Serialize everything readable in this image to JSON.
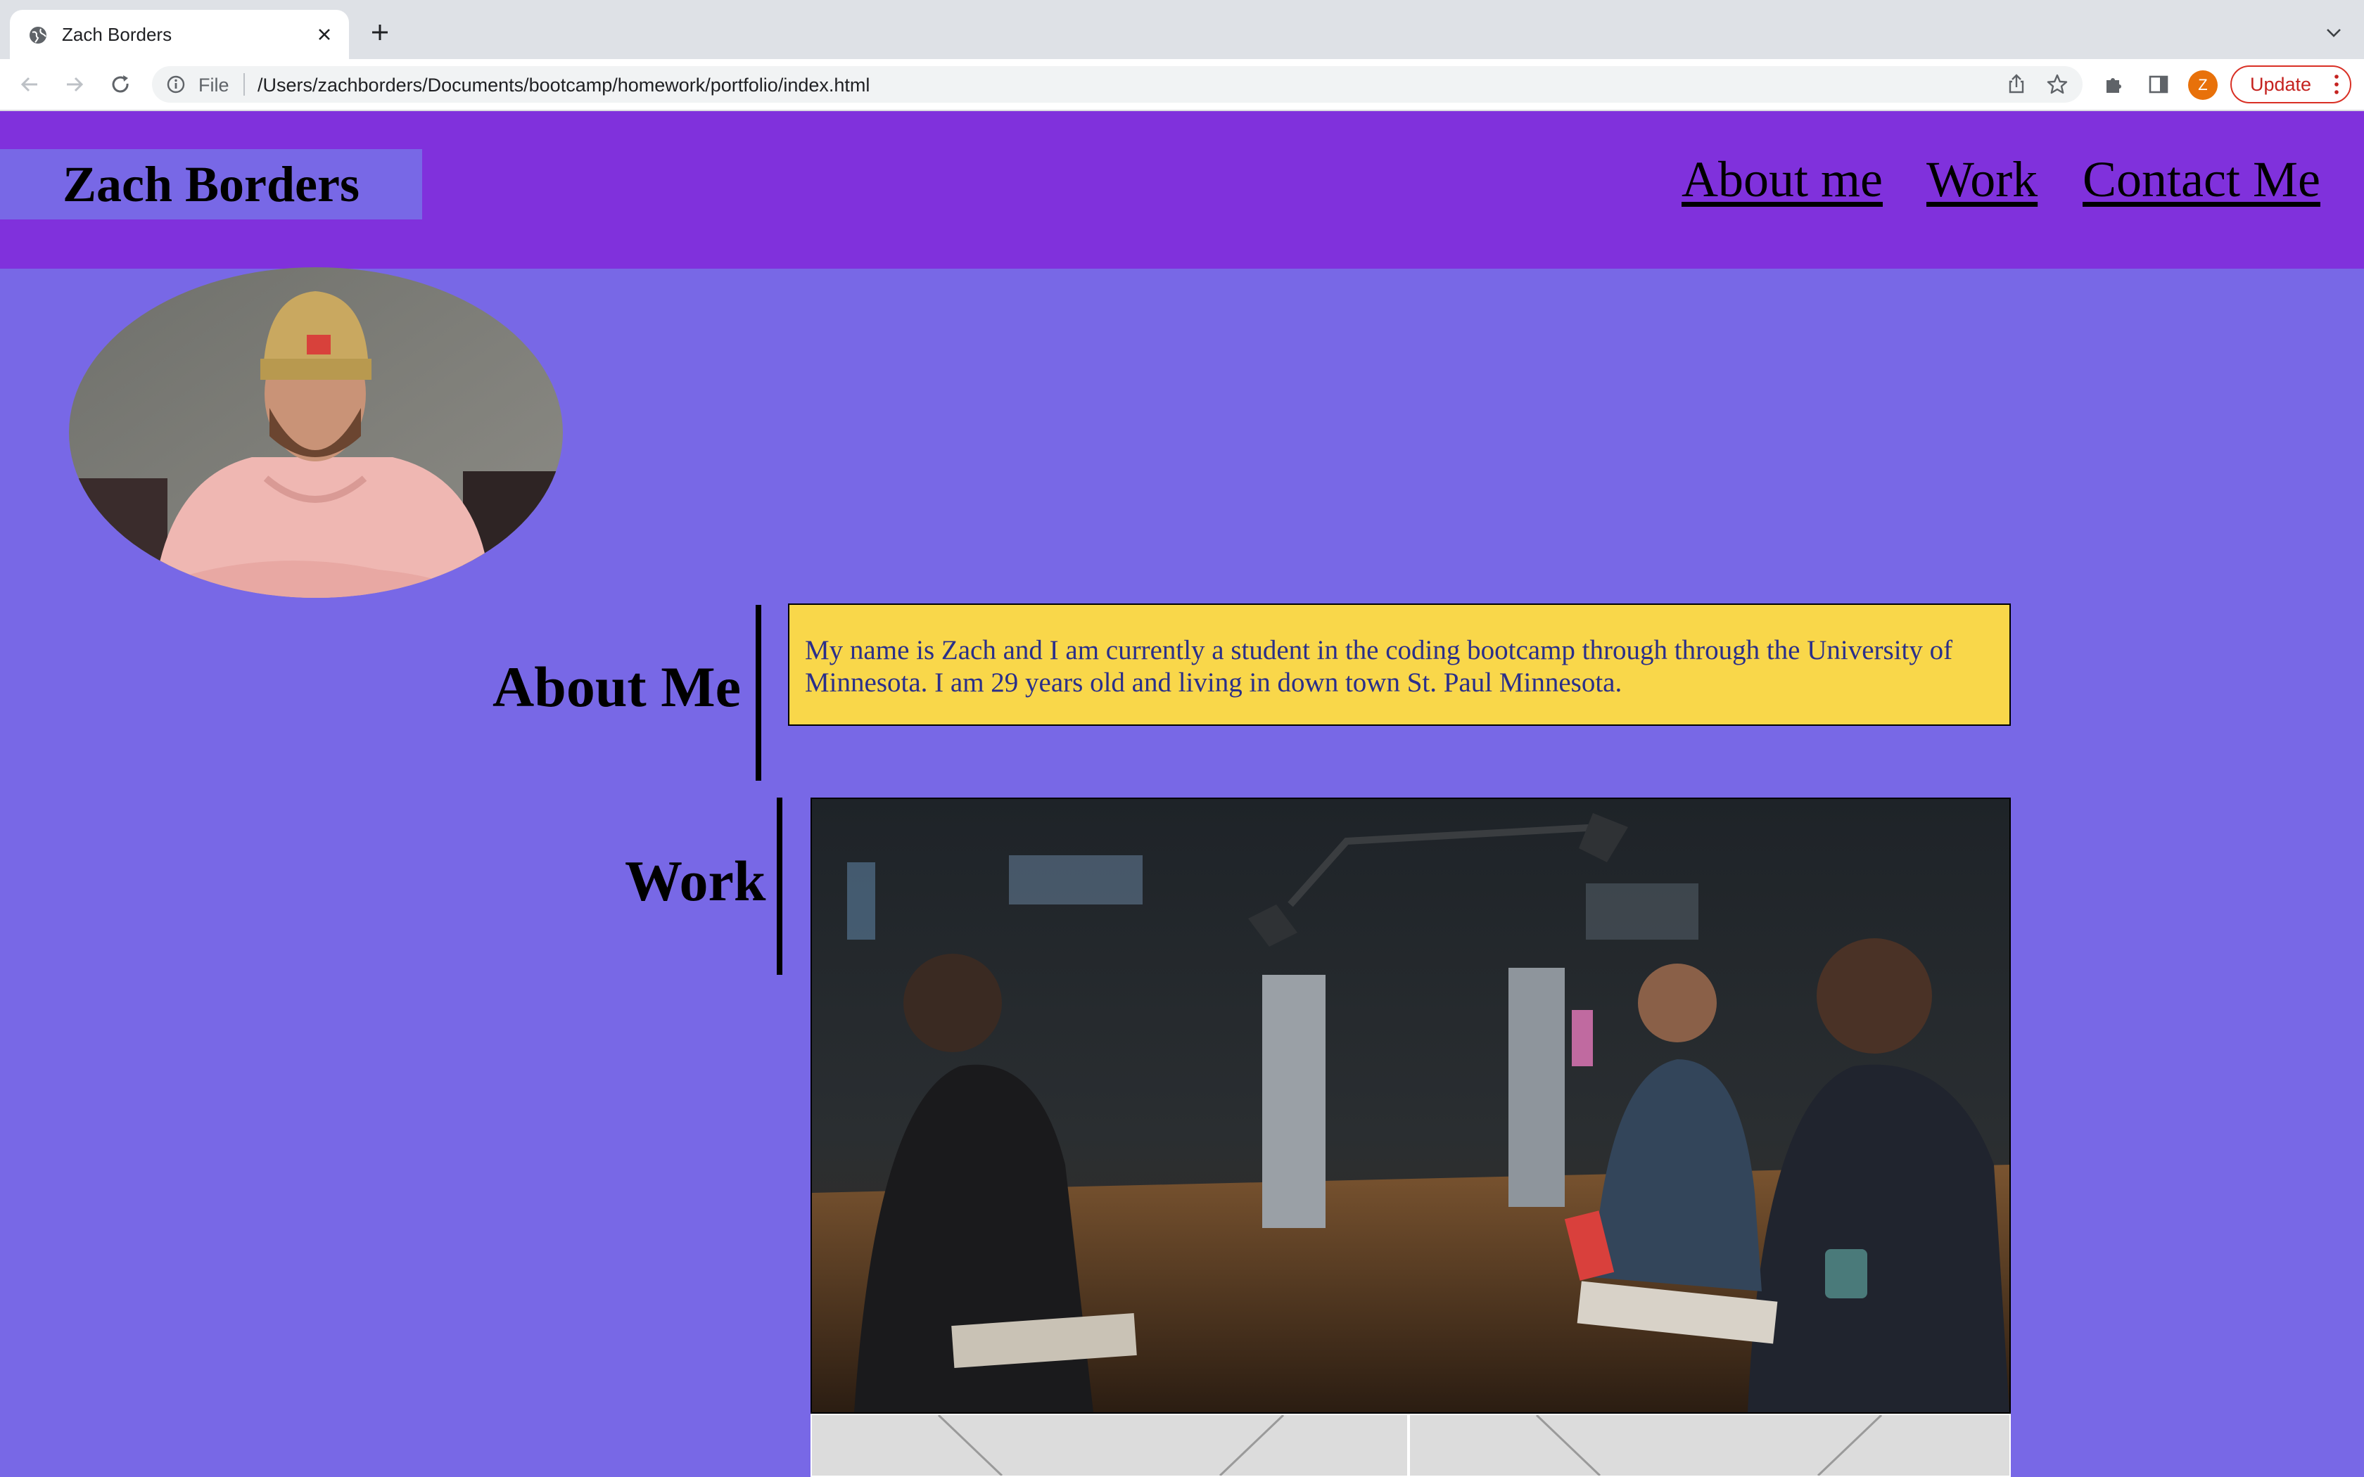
{
  "browser": {
    "tab": {
      "title": "Zach Borders"
    },
    "address": {
      "scheme": "File",
      "url": "/Users/zachborders/Documents/bootcamp/homework/portfolio/index.html"
    },
    "profile_initial": "Z",
    "update_label": "Update"
  },
  "site": {
    "brand": "Zach Borders",
    "nav": [
      "About me",
      "Work",
      "Contact Me"
    ],
    "about": {
      "title": "About Me",
      "text": "My name is Zach and I am currently a student in the coding bootcamp through through the University of Minnesota. I am 29 years old and living in down town St. Paul Minnesota."
    },
    "work": {
      "title": "Work"
    }
  },
  "colors": {
    "page_bg": "#7868e6",
    "header_bg": "#8031dc",
    "about_box_bg": "#f9d74a",
    "about_text": "#2a2f8a"
  }
}
